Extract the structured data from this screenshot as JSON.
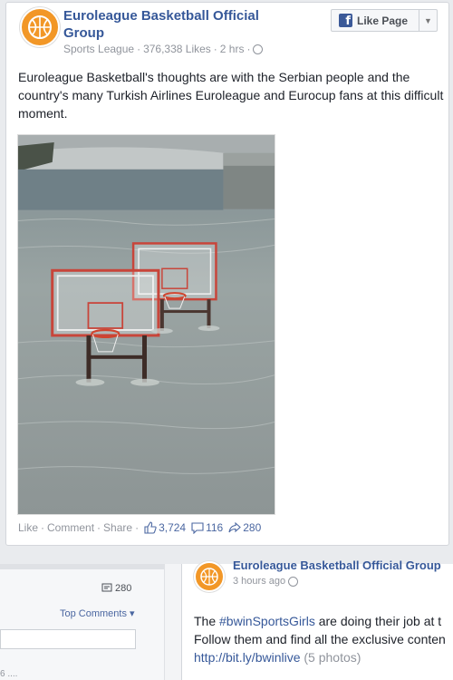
{
  "post": {
    "page_name": "Euroleague Basketball Official Group",
    "category": "Sports League",
    "likes": "376,338 Likes",
    "time": "2 hrs",
    "like_page_label": "Like Page",
    "text": "Euroleague Basketball's thoughts are with the Serbian people and the country's many Turkish Airlines Euroleague and Eurocup fans at this difficult moment.",
    "actions": {
      "like": "Like",
      "comment": "Comment",
      "share": "Share"
    },
    "counts": {
      "likes": "3,724",
      "comments": "116",
      "shares": "280"
    }
  },
  "background": {
    "comment_count": "280",
    "top_comments": "Top Comments ▾",
    "small_text": "6 ....",
    "next_post": {
      "page_name": "Euroleague Basketball Official Group",
      "time": "3 hours ago",
      "line1_pre": "The ",
      "line1_link": "#bwinSportsGirls",
      "line1_post": " are doing their job at t",
      "line2": "Follow them and find all the exclusive conten",
      "line3_link": "http://bit.ly/bwinlive",
      "line3_post": "(5 photos)"
    }
  },
  "colors": {
    "link": "#365899",
    "brand_orange": "#f29727",
    "muted": "#90949c"
  }
}
